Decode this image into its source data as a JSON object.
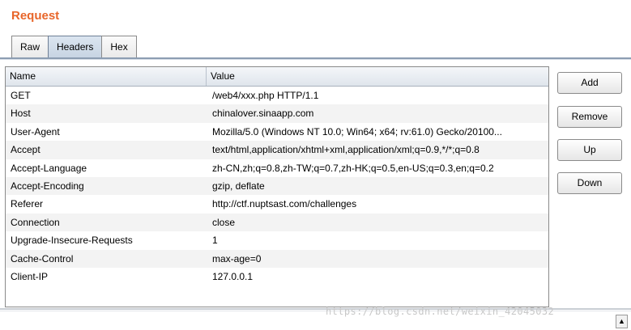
{
  "panel": {
    "title": "Request"
  },
  "tabs": [
    {
      "label": "Raw",
      "active": false
    },
    {
      "label": "Headers",
      "active": true
    },
    {
      "label": "Hex",
      "active": false
    }
  ],
  "table": {
    "columns": [
      "Name",
      "Value"
    ],
    "rows": [
      {
        "name": "GET",
        "value": "/web4/xxx.php HTTP/1.1"
      },
      {
        "name": "Host",
        "value": "chinalover.sinaapp.com"
      },
      {
        "name": "User-Agent",
        "value": "Mozilla/5.0 (Windows NT 10.0; Win64; x64; rv:61.0) Gecko/20100..."
      },
      {
        "name": "Accept",
        "value": "text/html,application/xhtml+xml,application/xml;q=0.9,*/*;q=0.8"
      },
      {
        "name": "Accept-Language",
        "value": "zh-CN,zh;q=0.8,zh-TW;q=0.7,zh-HK;q=0.5,en-US;q=0.3,en;q=0.2"
      },
      {
        "name": "Accept-Encoding",
        "value": "gzip, deflate"
      },
      {
        "name": "Referer",
        "value": "http://ctf.nuptsast.com/challenges"
      },
      {
        "name": "Connection",
        "value": "close"
      },
      {
        "name": "Upgrade-Insecure-Requests",
        "value": "1"
      },
      {
        "name": "Cache-Control",
        "value": "max-age=0"
      },
      {
        "name": "Client-IP",
        "value": "127.0.0.1"
      }
    ]
  },
  "buttons": {
    "add": "Add",
    "remove": "Remove",
    "up": "Up",
    "down": "Down"
  },
  "scroll": {
    "up_glyph": "▲"
  },
  "watermark": "https://blog.csdn.net/weixin_42045032",
  "colors": {
    "title": "#e8662a",
    "active_tab": "#c6d3e2",
    "tab_rule": "#8c9db2"
  }
}
